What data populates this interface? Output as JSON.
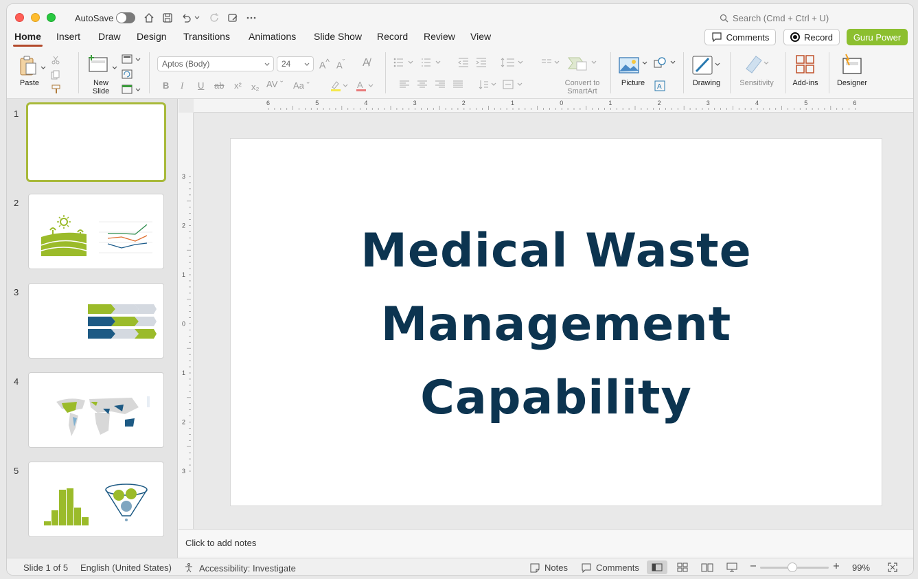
{
  "titlebar": {
    "autosave_label": "AutoSave",
    "search_placeholder": "Search (Cmd + Ctrl + U)"
  },
  "tabs": [
    {
      "label": "Home",
      "active": true
    },
    {
      "label": "Insert"
    },
    {
      "label": "Draw"
    },
    {
      "label": "Design"
    },
    {
      "label": "Transitions"
    },
    {
      "label": "Animations"
    },
    {
      "label": "Slide Show"
    },
    {
      "label": "Record"
    },
    {
      "label": "Review"
    },
    {
      "label": "View"
    }
  ],
  "actions": {
    "comments": "Comments",
    "record": "Record",
    "guru_power": "Guru Power"
  },
  "ribbon": {
    "paste": "Paste",
    "new_slide": "New Slide",
    "font_name": "Aptos (Body)",
    "font_size": "24",
    "convert_smartart": "Convert to SmartArt",
    "picture": "Picture",
    "drawing": "Drawing",
    "sensitivity": "Sensitivity",
    "addins": "Add-ins",
    "designer": "Designer"
  },
  "slides": [
    {
      "number": "1"
    },
    {
      "number": "2"
    },
    {
      "number": "3"
    },
    {
      "number": "4"
    },
    {
      "number": "5"
    }
  ],
  "slide": {
    "title_line1": "Medical Waste",
    "title_line2": "Management",
    "title_line3": "Capability"
  },
  "notes_placeholder": "Click to add notes",
  "statusbar": {
    "slide_count": "Slide 1 of 5",
    "language": "English (United States)",
    "accessibility": "Accessibility: Investigate",
    "notes": "Notes",
    "comments": "Comments",
    "zoom": "99%"
  },
  "ruler": {
    "top_labels": [
      "6",
      "5",
      "4",
      "3",
      "2",
      "1",
      "0",
      "1",
      "2",
      "3",
      "4",
      "5",
      "6"
    ],
    "left_labels": [
      "3",
      "2",
      "1",
      "0",
      "1",
      "2",
      "3"
    ]
  },
  "colors": {
    "title": "#0c3450",
    "accent_green": "#8cbf2f",
    "tab_underline": "#b34a2c"
  }
}
